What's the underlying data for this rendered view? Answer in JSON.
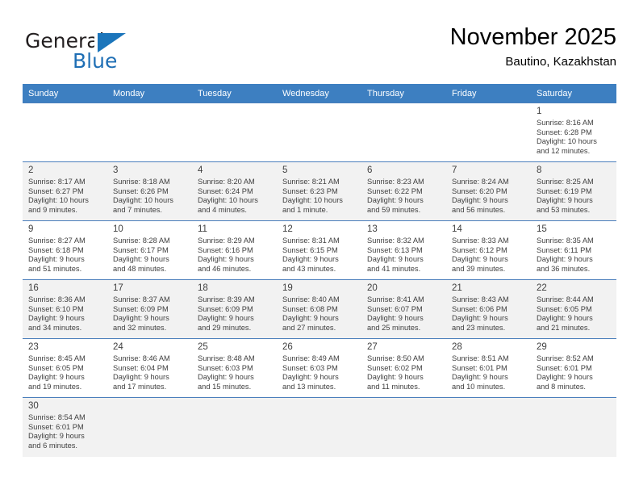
{
  "brand": {
    "name_part1": "General",
    "name_part2": "Blue",
    "accent_color": "#1b75bb"
  },
  "header": {
    "month_title": "November 2025",
    "location": "Bautino, Kazakhstan"
  },
  "theme": {
    "header_row_bg": "#3d7fc1",
    "alt_row_bg": "#f2f2f2",
    "grid_line": "#4a7ebb",
    "text": "#3f3f3f"
  },
  "weekday_headers": [
    "Sunday",
    "Monday",
    "Tuesday",
    "Wednesday",
    "Thursday",
    "Friday",
    "Saturday"
  ],
  "labels": {
    "sunrise": "Sunrise:",
    "sunset": "Sunset:",
    "daylight": "Daylight:"
  },
  "weeks": [
    [
      {
        "day": "",
        "empty": true
      },
      {
        "day": "",
        "empty": true
      },
      {
        "day": "",
        "empty": true
      },
      {
        "day": "",
        "empty": true
      },
      {
        "day": "",
        "empty": true
      },
      {
        "day": "",
        "empty": true
      },
      {
        "day": "1",
        "sunrise": "Sunrise: 8:16 AM",
        "sunset": "Sunset: 6:28 PM",
        "daylight_line1": "Daylight: 10 hours",
        "daylight_line2": "and 12 minutes."
      }
    ],
    [
      {
        "day": "2",
        "sunrise": "Sunrise: 8:17 AM",
        "sunset": "Sunset: 6:27 PM",
        "daylight_line1": "Daylight: 10 hours",
        "daylight_line2": "and 9 minutes."
      },
      {
        "day": "3",
        "sunrise": "Sunrise: 8:18 AM",
        "sunset": "Sunset: 6:26 PM",
        "daylight_line1": "Daylight: 10 hours",
        "daylight_line2": "and 7 minutes."
      },
      {
        "day": "4",
        "sunrise": "Sunrise: 8:20 AM",
        "sunset": "Sunset: 6:24 PM",
        "daylight_line1": "Daylight: 10 hours",
        "daylight_line2": "and 4 minutes."
      },
      {
        "day": "5",
        "sunrise": "Sunrise: 8:21 AM",
        "sunset": "Sunset: 6:23 PM",
        "daylight_line1": "Daylight: 10 hours",
        "daylight_line2": "and 1 minute."
      },
      {
        "day": "6",
        "sunrise": "Sunrise: 8:23 AM",
        "sunset": "Sunset: 6:22 PM",
        "daylight_line1": "Daylight: 9 hours",
        "daylight_line2": "and 59 minutes."
      },
      {
        "day": "7",
        "sunrise": "Sunrise: 8:24 AM",
        "sunset": "Sunset: 6:20 PM",
        "daylight_line1": "Daylight: 9 hours",
        "daylight_line2": "and 56 minutes."
      },
      {
        "day": "8",
        "sunrise": "Sunrise: 8:25 AM",
        "sunset": "Sunset: 6:19 PM",
        "daylight_line1": "Daylight: 9 hours",
        "daylight_line2": "and 53 minutes."
      }
    ],
    [
      {
        "day": "9",
        "sunrise": "Sunrise: 8:27 AM",
        "sunset": "Sunset: 6:18 PM",
        "daylight_line1": "Daylight: 9 hours",
        "daylight_line2": "and 51 minutes."
      },
      {
        "day": "10",
        "sunrise": "Sunrise: 8:28 AM",
        "sunset": "Sunset: 6:17 PM",
        "daylight_line1": "Daylight: 9 hours",
        "daylight_line2": "and 48 minutes."
      },
      {
        "day": "11",
        "sunrise": "Sunrise: 8:29 AM",
        "sunset": "Sunset: 6:16 PM",
        "daylight_line1": "Daylight: 9 hours",
        "daylight_line2": "and 46 minutes."
      },
      {
        "day": "12",
        "sunrise": "Sunrise: 8:31 AM",
        "sunset": "Sunset: 6:15 PM",
        "daylight_line1": "Daylight: 9 hours",
        "daylight_line2": "and 43 minutes."
      },
      {
        "day": "13",
        "sunrise": "Sunrise: 8:32 AM",
        "sunset": "Sunset: 6:13 PM",
        "daylight_line1": "Daylight: 9 hours",
        "daylight_line2": "and 41 minutes."
      },
      {
        "day": "14",
        "sunrise": "Sunrise: 8:33 AM",
        "sunset": "Sunset: 6:12 PM",
        "daylight_line1": "Daylight: 9 hours",
        "daylight_line2": "and 39 minutes."
      },
      {
        "day": "15",
        "sunrise": "Sunrise: 8:35 AM",
        "sunset": "Sunset: 6:11 PM",
        "daylight_line1": "Daylight: 9 hours",
        "daylight_line2": "and 36 minutes."
      }
    ],
    [
      {
        "day": "16",
        "sunrise": "Sunrise: 8:36 AM",
        "sunset": "Sunset: 6:10 PM",
        "daylight_line1": "Daylight: 9 hours",
        "daylight_line2": "and 34 minutes."
      },
      {
        "day": "17",
        "sunrise": "Sunrise: 8:37 AM",
        "sunset": "Sunset: 6:09 PM",
        "daylight_line1": "Daylight: 9 hours",
        "daylight_line2": "and 32 minutes."
      },
      {
        "day": "18",
        "sunrise": "Sunrise: 8:39 AM",
        "sunset": "Sunset: 6:09 PM",
        "daylight_line1": "Daylight: 9 hours",
        "daylight_line2": "and 29 minutes."
      },
      {
        "day": "19",
        "sunrise": "Sunrise: 8:40 AM",
        "sunset": "Sunset: 6:08 PM",
        "daylight_line1": "Daylight: 9 hours",
        "daylight_line2": "and 27 minutes."
      },
      {
        "day": "20",
        "sunrise": "Sunrise: 8:41 AM",
        "sunset": "Sunset: 6:07 PM",
        "daylight_line1": "Daylight: 9 hours",
        "daylight_line2": "and 25 minutes."
      },
      {
        "day": "21",
        "sunrise": "Sunrise: 8:43 AM",
        "sunset": "Sunset: 6:06 PM",
        "daylight_line1": "Daylight: 9 hours",
        "daylight_line2": "and 23 minutes."
      },
      {
        "day": "22",
        "sunrise": "Sunrise: 8:44 AM",
        "sunset": "Sunset: 6:05 PM",
        "daylight_line1": "Daylight: 9 hours",
        "daylight_line2": "and 21 minutes."
      }
    ],
    [
      {
        "day": "23",
        "sunrise": "Sunrise: 8:45 AM",
        "sunset": "Sunset: 6:05 PM",
        "daylight_line1": "Daylight: 9 hours",
        "daylight_line2": "and 19 minutes."
      },
      {
        "day": "24",
        "sunrise": "Sunrise: 8:46 AM",
        "sunset": "Sunset: 6:04 PM",
        "daylight_line1": "Daylight: 9 hours",
        "daylight_line2": "and 17 minutes."
      },
      {
        "day": "25",
        "sunrise": "Sunrise: 8:48 AM",
        "sunset": "Sunset: 6:03 PM",
        "daylight_line1": "Daylight: 9 hours",
        "daylight_line2": "and 15 minutes."
      },
      {
        "day": "26",
        "sunrise": "Sunrise: 8:49 AM",
        "sunset": "Sunset: 6:03 PM",
        "daylight_line1": "Daylight: 9 hours",
        "daylight_line2": "and 13 minutes."
      },
      {
        "day": "27",
        "sunrise": "Sunrise: 8:50 AM",
        "sunset": "Sunset: 6:02 PM",
        "daylight_line1": "Daylight: 9 hours",
        "daylight_line2": "and 11 minutes."
      },
      {
        "day": "28",
        "sunrise": "Sunrise: 8:51 AM",
        "sunset": "Sunset: 6:01 PM",
        "daylight_line1": "Daylight: 9 hours",
        "daylight_line2": "and 10 minutes."
      },
      {
        "day": "29",
        "sunrise": "Sunrise: 8:52 AM",
        "sunset": "Sunset: 6:01 PM",
        "daylight_line1": "Daylight: 9 hours",
        "daylight_line2": "and 8 minutes."
      }
    ],
    [
      {
        "day": "30",
        "sunrise": "Sunrise: 8:54 AM",
        "sunset": "Sunset: 6:01 PM",
        "daylight_line1": "Daylight: 9 hours",
        "daylight_line2": "and 6 minutes."
      },
      {
        "day": "",
        "empty": true
      },
      {
        "day": "",
        "empty": true
      },
      {
        "day": "",
        "empty": true
      },
      {
        "day": "",
        "empty": true
      },
      {
        "day": "",
        "empty": true
      },
      {
        "day": "",
        "empty": true
      }
    ]
  ]
}
